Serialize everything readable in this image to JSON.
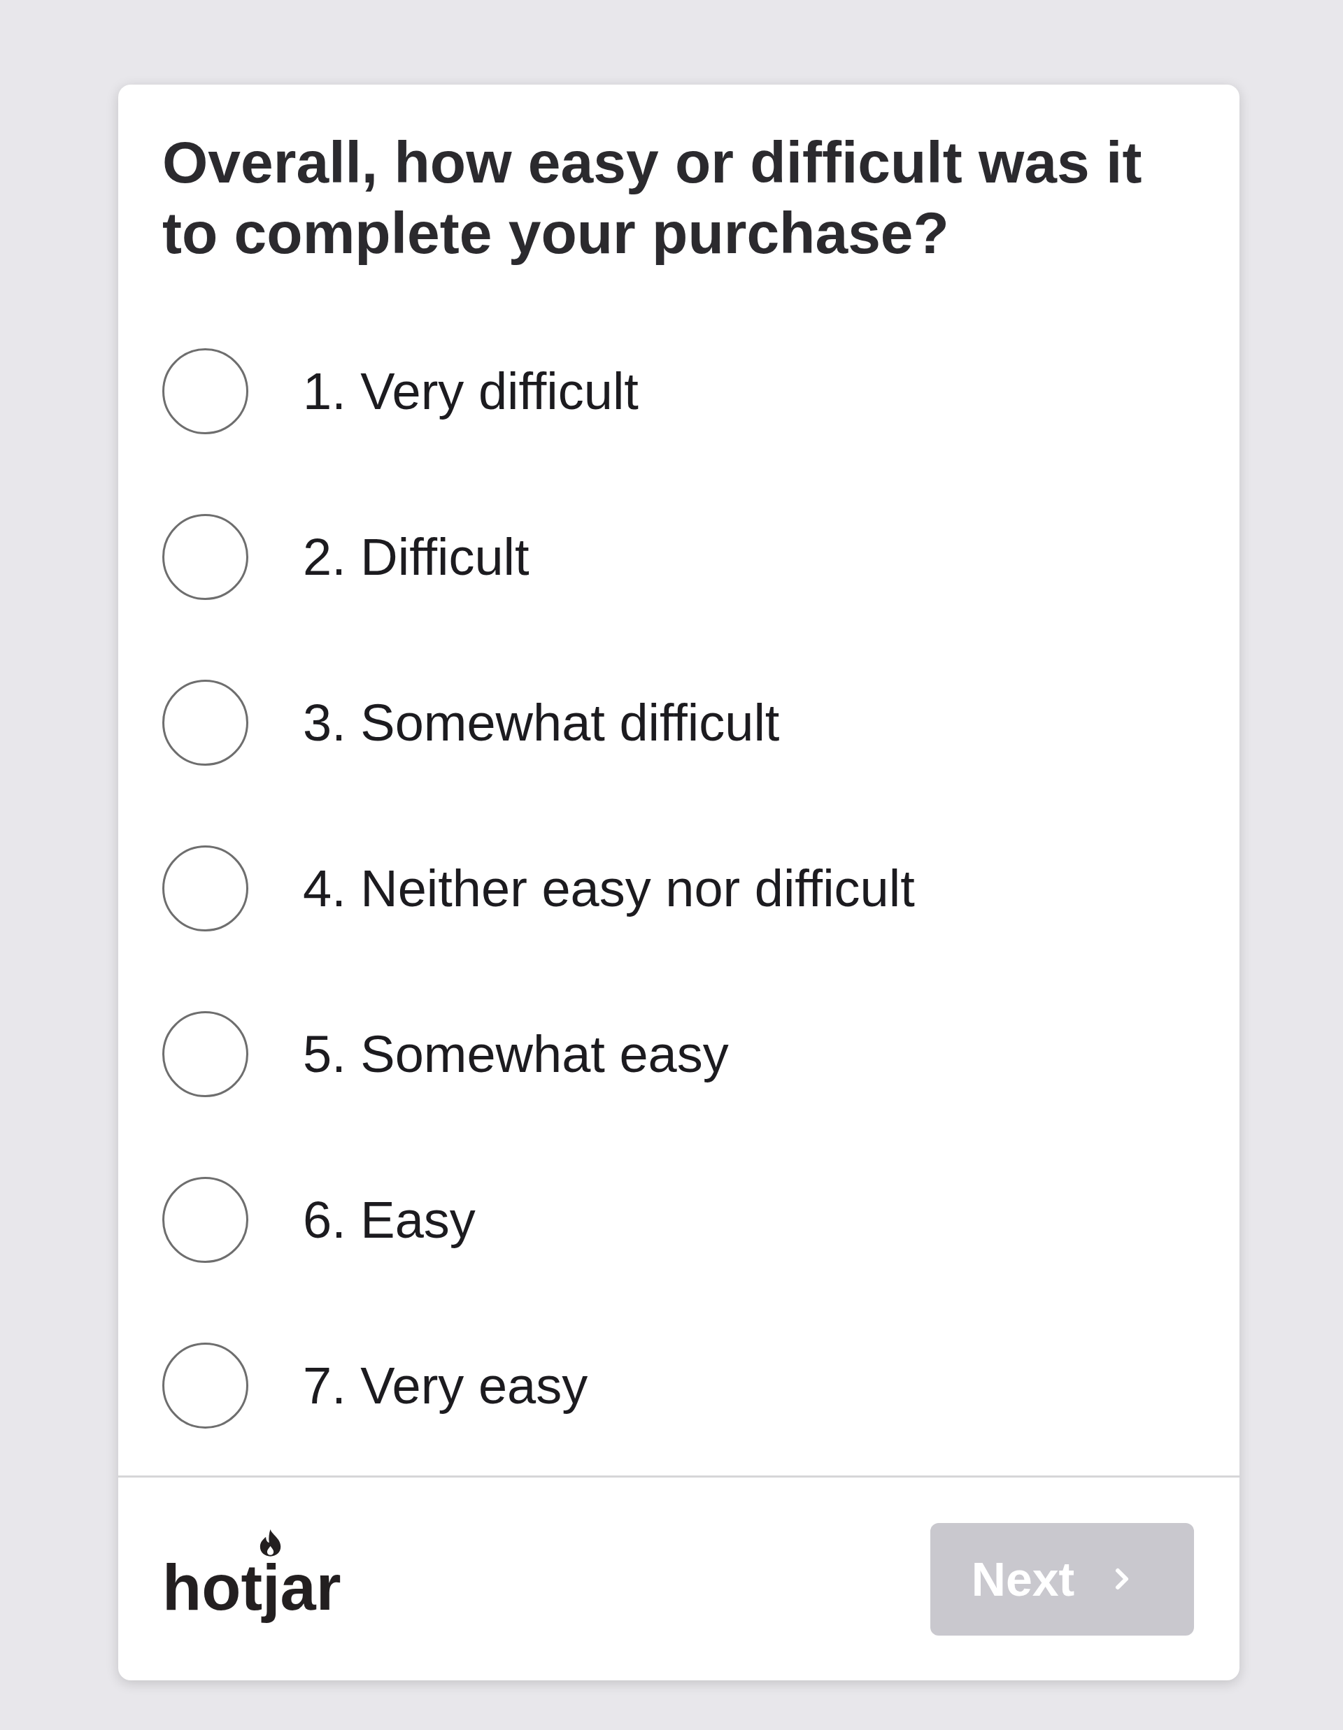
{
  "survey": {
    "question": "Overall, how easy or difficult was it to complete your purchase?",
    "options": [
      {
        "label": "1. Very difficult",
        "selected": false
      },
      {
        "label": "2. Difficult",
        "selected": false
      },
      {
        "label": "3. Somewhat difficult",
        "selected": false
      },
      {
        "label": "4. Neither easy nor difficult",
        "selected": false
      },
      {
        "label": "5. Somewhat easy",
        "selected": false
      },
      {
        "label": "6. Easy",
        "selected": false
      },
      {
        "label": "7. Very easy",
        "selected": false
      }
    ]
  },
  "footer": {
    "logo": "hotjar",
    "next_button": {
      "label": "Next",
      "disabled": true
    }
  }
}
